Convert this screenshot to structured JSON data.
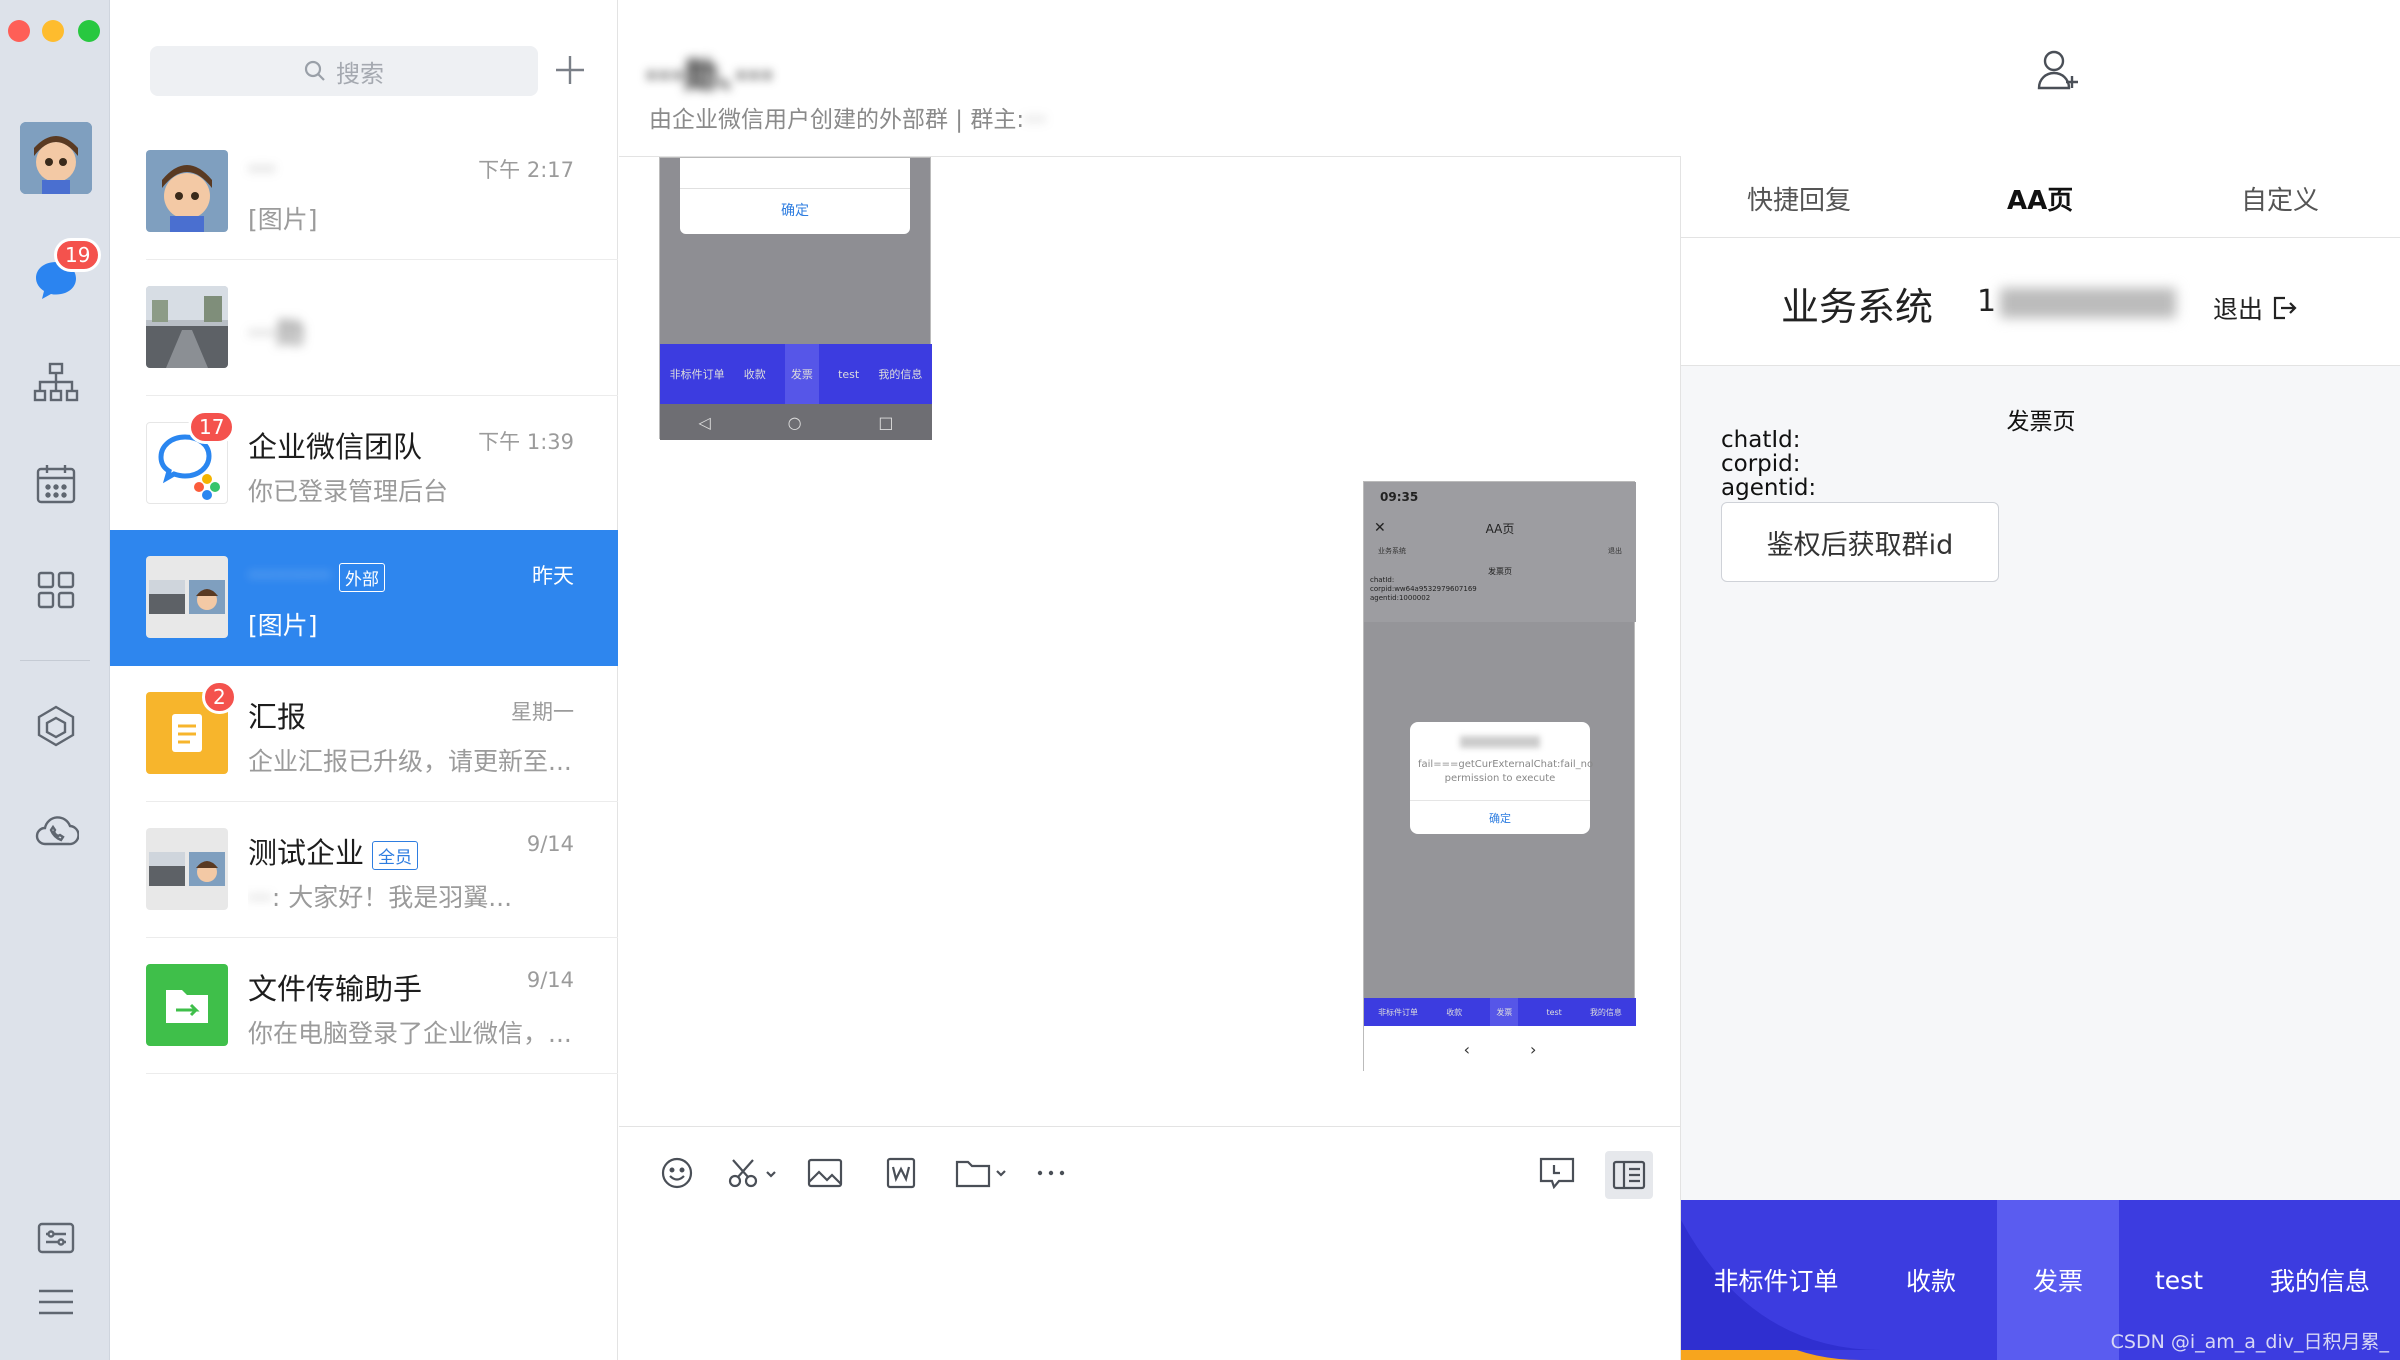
{
  "window": {
    "traffic_lights": [
      "#fe5f57",
      "#febc2e",
      "#28c840"
    ]
  },
  "rail": {
    "chat_badge": "19",
    "items": [
      "profile-avatar",
      "chat-icon",
      "org-chart-icon",
      "calendar-icon",
      "apps-icon",
      "workbench-icon",
      "cloud-phone-icon",
      "settings-icon",
      "menu-icon"
    ]
  },
  "search": {
    "placeholder": "搜索",
    "add_label": "+"
  },
  "chats": [
    {
      "name": "···",
      "time": "下午 2:17",
      "preview": "[图片]",
      "blurred": true
    },
    {
      "name": "···勋",
      "time": "",
      "preview": "",
      "blurred": true
    },
    {
      "name": "企业微信团队",
      "time": "下午 1:39",
      "preview": "你已登录管理后台",
      "badge": "17"
    },
    {
      "name": "·········",
      "tag": "外部",
      "time": "昨天",
      "preview": "[图片]",
      "selected": true
    },
    {
      "name": "汇报",
      "time": "星期一",
      "preview": "企业汇报已升级，请更新至...",
      "badge": "2"
    },
    {
      "name": "测试企业",
      "tag": "全员",
      "time": "9/14",
      "preview_blur": "···",
      "preview": ": 大家好！我是羽翼..."
    },
    {
      "name": "文件传输助手",
      "time": "9/14",
      "preview": "你在电脑登录了企业微信，..."
    }
  ],
  "chat": {
    "title": "···勋、···",
    "subtitle": "由企业微信用户创建的外部群 | 群主:",
    "subtitle_blur": "···"
  },
  "phone_top": {
    "confirm": "确定",
    "tabs": [
      "非标件订单",
      "收款",
      "发票",
      "test",
      "我的信息"
    ]
  },
  "phone_right": {
    "status_time": "09:35",
    "header": "AA页",
    "biz_label": "业务系统",
    "logout": "退出",
    "page_title": "发票页",
    "chat_lines": [
      "chatId:",
      "corpid:ww64a9532979607169",
      "agentid:1000002"
    ],
    "dialog_text": "fail===getCurExternalChat:fail_no permission to execute",
    "dialog_ok": "确定",
    "tabs": [
      "非标件订单",
      "收款",
      "发票",
      "test",
      "我的信息"
    ]
  },
  "panel": {
    "tabs": [
      "快捷回复",
      "AA页",
      "自定义"
    ],
    "active_tab": "AA页",
    "system_name": "业务系统",
    "account_prefix": "1",
    "logout": "退出",
    "page_title": "发票页",
    "fields": [
      "chatId:",
      "corpid:",
      "agentid:"
    ],
    "button": "鉴权后获取群id",
    "bottom_nav": [
      "非标件订单",
      "收款",
      "发票",
      "test",
      "我的信息"
    ],
    "bottom_active": "发票"
  },
  "watermark": "CSDN @i_am_a_div_日积月累_"
}
